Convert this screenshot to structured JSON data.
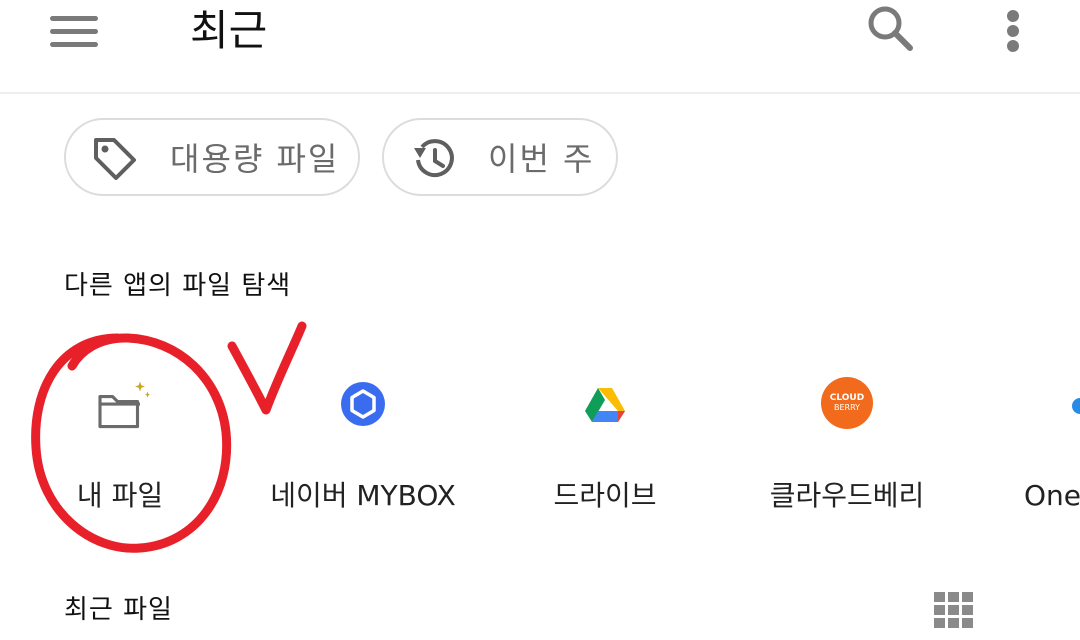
{
  "header": {
    "title": "최근",
    "menu_icon": "hamburger-menu-icon",
    "search_icon": "search-icon",
    "more_icon": "more-vert-icon"
  },
  "filters": [
    {
      "label": "대용량 파일",
      "icon": "tag-icon"
    },
    {
      "label": "이번 주",
      "icon": "history-icon"
    }
  ],
  "explore": {
    "title": "다른 앱의 파일 탐색",
    "apps": [
      {
        "label": "내 파일",
        "icon": "my-files-folder-icon"
      },
      {
        "label": "네이버 MYBOX",
        "icon": "naver-mybox-icon"
      },
      {
        "label": "드라이브",
        "icon": "google-drive-icon"
      },
      {
        "label": "클라우드베리",
        "icon": "cloudberry-icon",
        "badge_line1": "CLOUD",
        "badge_line2": "BERRY"
      },
      {
        "label": "One",
        "icon": "onedrive-icon"
      }
    ]
  },
  "recent": {
    "title": "최근 파일",
    "view_icon": "grid-view-icon"
  },
  "colors": {
    "annotation": "#e8202a",
    "accent_blue": "#3a6cf0",
    "cloudberry_orange": "#f26b1d"
  }
}
